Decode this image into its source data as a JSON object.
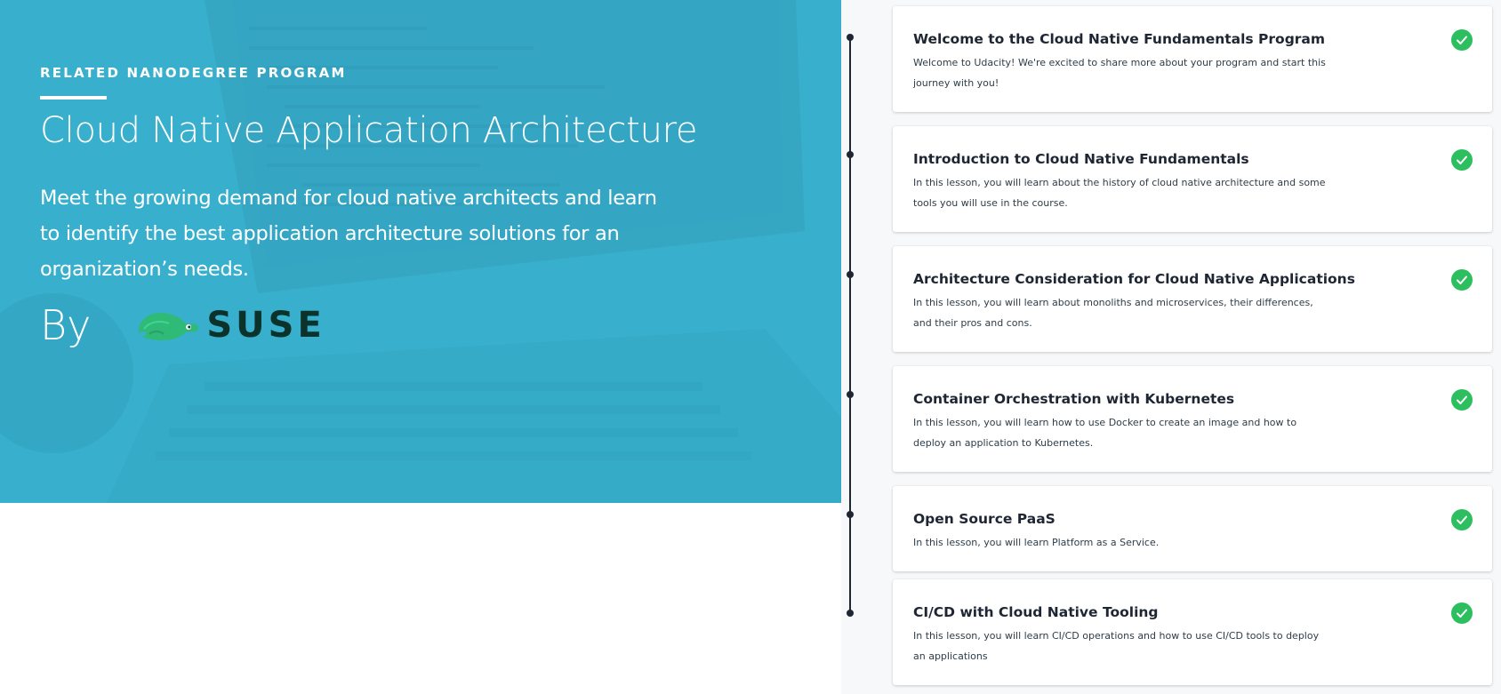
{
  "hero": {
    "eyebrow": "RELATED NANODEGREE PROGRAM",
    "title": "Cloud Native Application Architecture",
    "description": "Meet the growing demand for cloud native architects and learn to identify the best application architecture solutions for an organization’s needs.",
    "by_label": "By",
    "partner_logo_text": "SUSE",
    "background_color": "#3bb2cf",
    "partner_logo_color": "#0c322c",
    "partner_mascot_color": "#30ba78"
  },
  "lessons": [
    {
      "title": "Welcome to the Cloud Native Fundamentals Program",
      "description": "Welcome to Udacity! We're excited to share more about your program and start this journey with you!",
      "completed": true
    },
    {
      "title": "Introduction to Cloud Native Fundamentals",
      "description": "In this lesson, you will learn about the history of cloud native architecture and some tools you will use in the course.",
      "completed": true
    },
    {
      "title": "Architecture Consideration for Cloud Native Applications",
      "description": "In this lesson, you will learn about monoliths and microservices, their differences, and their pros and cons.",
      "completed": true
    },
    {
      "title": "Container Orchestration with Kubernetes",
      "description": "In this lesson, you will learn how to use Docker to create an image and how to deploy an application to Kubernetes.",
      "completed": true
    },
    {
      "title": "Open Source PaaS",
      "description": "In this lesson, you will learn Platform as a Service.",
      "completed": true
    },
    {
      "title": "CI/CD with Cloud Native Tooling",
      "description": "In this lesson, you will learn CI/CD operations and how to use CI/CD tools to deploy an applications",
      "completed": true
    }
  ],
  "icons": {
    "completed": "check-circle-icon",
    "timeline_node": "timeline-dot-icon"
  },
  "colors": {
    "check_green": "#2dbe60",
    "timeline": "#1f2633",
    "panel_background": "#f7f8fa"
  }
}
